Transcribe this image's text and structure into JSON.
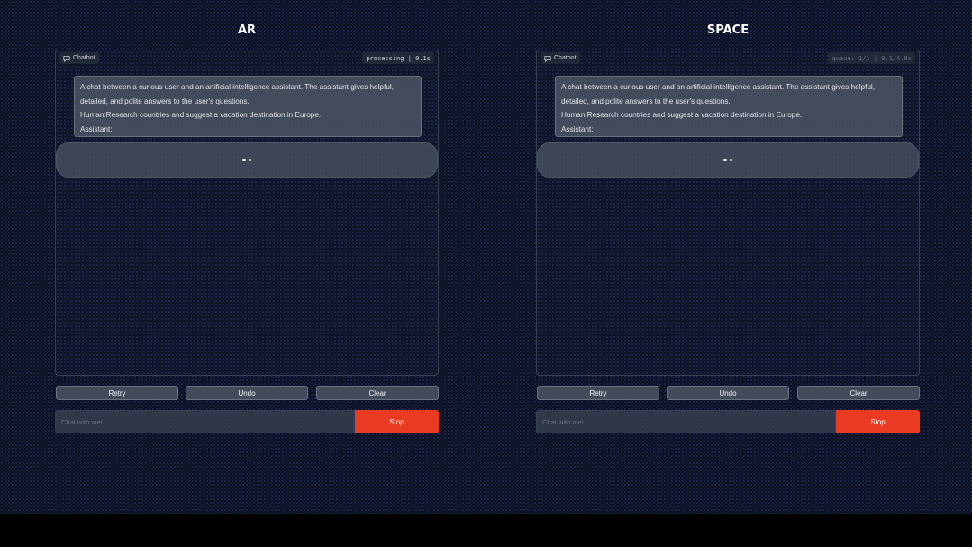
{
  "panes": [
    {
      "title": "AR",
      "chatbot": {
        "label": "Chatbot",
        "status": "processing | 0.1s",
        "system_prompt": "A chat between a curious user and an artificial intelligence assistant. The assistant gives helpful, detailed, and polite answers to the user's questions.",
        "human_line": "Human:Research countries and suggest a vacation destination in Europe.",
        "assistant_line": "Assistant:",
        "bot_state": "typing"
      },
      "buttons": {
        "retry": "Retry",
        "undo": "Undo",
        "clear": "Clear"
      },
      "input": {
        "placeholder": "Chat with me!",
        "value": ""
      },
      "stop_label": "Stop"
    },
    {
      "title": "SPACE",
      "chatbot": {
        "label": "Chatbot",
        "status": "queue: 1/1 | 0.1/4.8s",
        "system_prompt": "A chat between a curious user and an artificial intelligence assistant. The assistant gives helpful, detailed, and polite answers to the user's questions.",
        "human_line": "Human:Research countries and suggest a vacation destination in Europe.",
        "assistant_line": "Assistant:",
        "bot_state": "typing"
      },
      "buttons": {
        "retry": "Retry",
        "undo": "Undo",
        "clear": "Clear"
      },
      "input": {
        "placeholder": "Chat with me!",
        "value": ""
      },
      "stop_label": "Stop"
    }
  ],
  "colors": {
    "background": "#0b0f1d",
    "stop_button": "#ea3a22",
    "message_bubble": "#4b5563"
  },
  "icons": {
    "chatbot_label": "chat-bubble-icon"
  }
}
